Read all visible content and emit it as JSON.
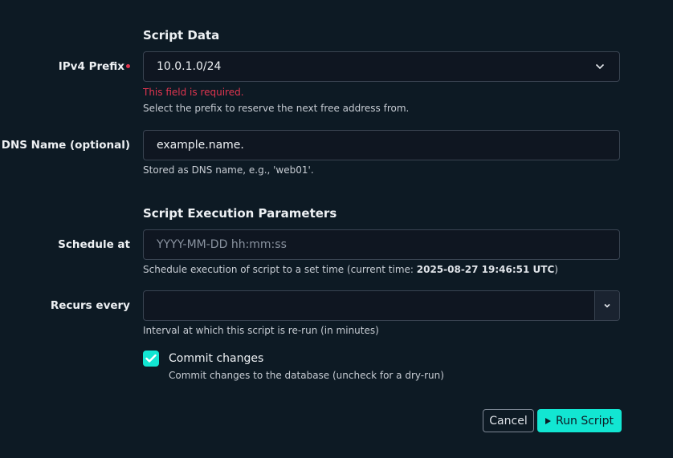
{
  "script_data": {
    "title": "Script Data",
    "ipv4_prefix": {
      "label": "IPv4 Prefix",
      "value": "10.0.1.0/24",
      "error": "This field is required.",
      "help": "Select the prefix to reserve the next free address from."
    },
    "dns_name": {
      "label": "DNS Name (optional)",
      "value": "example.name.",
      "help": "Stored as DNS name, e.g., 'web01'."
    }
  },
  "execution": {
    "title": "Script Execution Parameters",
    "schedule_at": {
      "label": "Schedule at",
      "placeholder": "YYYY-MM-DD hh:mm:ss",
      "help_prefix": "Schedule execution of script to a set time (current time: ",
      "help_time": "2025-08-27 19:46:51 UTC",
      "help_suffix": ")"
    },
    "recurs_every": {
      "label": "Recurs every",
      "value": "",
      "help": "Interval at which this script is re-run (in minutes)"
    },
    "commit": {
      "label": "Commit changes",
      "help": "Commit changes to the database (uncheck for a dry-run)",
      "checked": true
    }
  },
  "actions": {
    "cancel_label": "Cancel",
    "run_label": "Run Script"
  },
  "colors": {
    "background": "#0d1a24",
    "accent": "#12e6d2",
    "error": "#e0354f"
  }
}
